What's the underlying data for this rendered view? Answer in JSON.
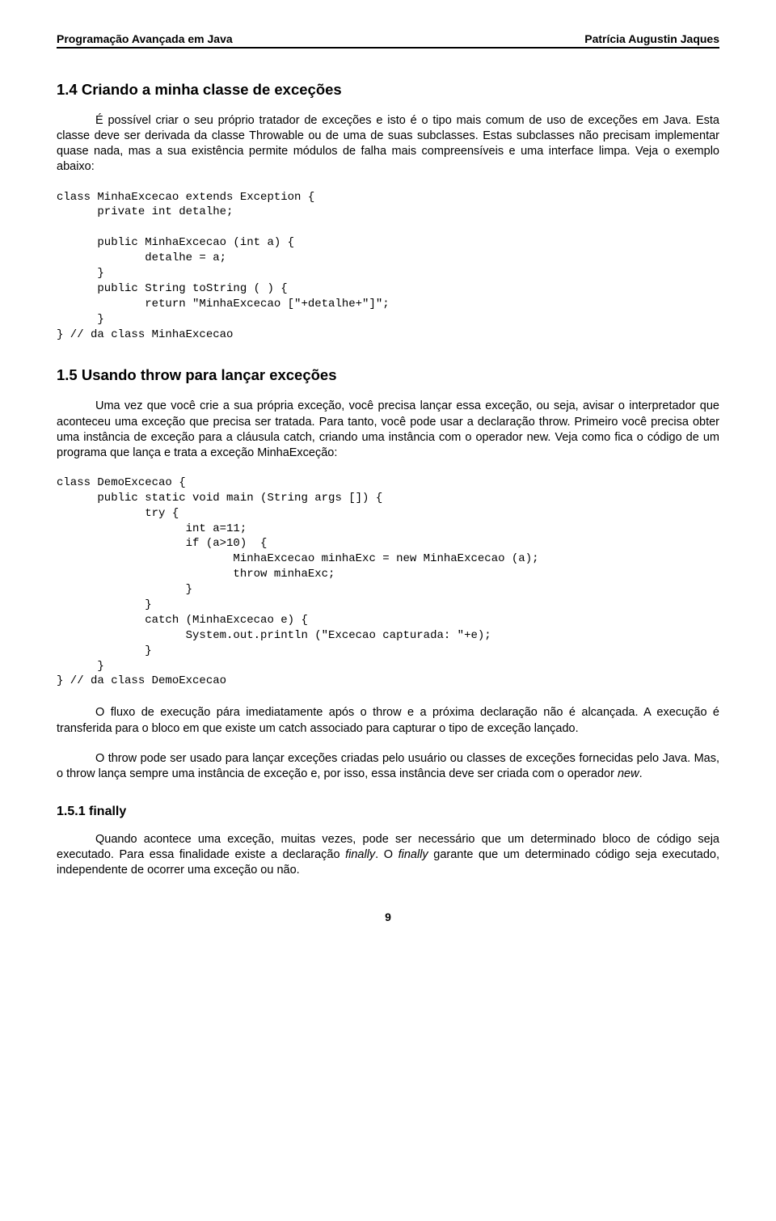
{
  "header": {
    "left": "Programação Avançada em Java",
    "right": "Patrícia Augustin Jaques"
  },
  "sections": {
    "s14": {
      "title": "1.4 Criando a minha classe de exceções",
      "p1": "É possível criar o seu próprio tratador de exceções e isto é o tipo mais comum de uso de exceções em Java. Esta classe deve ser derivada da classe Throwable ou de uma de suas subclasses. Estas subclasses não precisam implementar quase nada, mas a sua existência permite módulos de falha mais compreensíveis e uma interface limpa. Veja o exemplo abaixo:",
      "code1": "class MinhaExcecao extends Exception {\n      private int detalhe;\n\n      public MinhaExcecao (int a) {\n             detalhe = a;\n      }\n      public String toString ( ) {\n             return \"MinhaExcecao [\"+detalhe+\"]\";\n      }\n} // da class MinhaExcecao"
    },
    "s15": {
      "title": "1.5 Usando throw para lançar exceções",
      "p1": "Uma vez que você crie a sua própria exceção, você precisa lançar essa exceção, ou seja, avisar o interpretador que aconteceu uma exceção que precisa ser tratada. Para tanto, você pode usar a declaração throw. Primeiro você precisa obter uma instância de exceção para a cláusula catch, criando uma instância com o operador new. Veja como fica o código de um programa que lança e trata a exceção MinhaExceção:",
      "code1": "class DemoExcecao {\n      public static void main (String args []) {\n             try {\n                   int a=11;\n                   if (a>10)  {\n                          MinhaExcecao minhaExc = new MinhaExcecao (a);\n                          throw minhaExc;\n                   }\n             }\n             catch (MinhaExcecao e) {\n                   System.out.println (\"Excecao capturada: \"+e);\n             }\n      }\n} // da class DemoExcecao",
      "p2": "O fluxo de execução pára imediatamente após o throw e a próxima declaração não é alcançada. A execução é transferida para o bloco em que existe um catch associado para capturar o tipo de exceção lançado.",
      "p3_a": "O throw pode ser usado para lançar exceções criadas pelo usuário ou classes de exceções fornecidas pelo Java. Mas, o throw lança sempre uma instância de exceção e, por isso, essa instância deve ser criada com o operador ",
      "p3_b": "new",
      "p3_c": "."
    },
    "s151": {
      "title": "1.5.1   finally",
      "p1_a": "Quando acontece uma exceção, muitas vezes, pode ser necessário que um determinado bloco de código seja executado. Para essa finalidade existe a declaração ",
      "p1_b": "finally",
      "p1_c": ". O ",
      "p1_d": "finally",
      "p1_e": " garante que um determinado código seja executado, independente de ocorrer uma exceção ou não."
    }
  },
  "pagenum": "9"
}
